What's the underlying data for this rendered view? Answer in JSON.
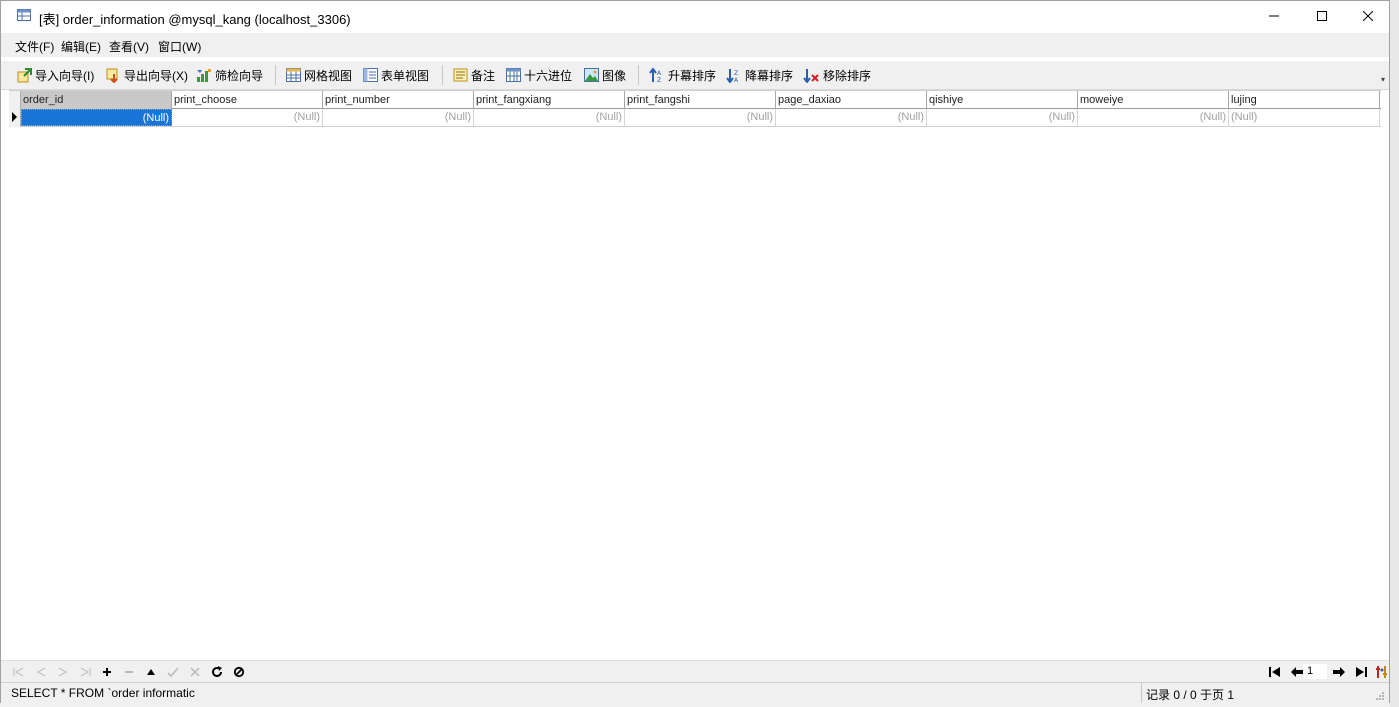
{
  "window": {
    "title": "[表] order_information @mysql_kang (localhost_3306)"
  },
  "menu": [
    {
      "label": "文件(F)"
    },
    {
      "label": "编辑(E)"
    },
    {
      "label": "查看(V)"
    },
    {
      "label": "窗口(W)"
    }
  ],
  "toolbar": {
    "import_label": "导入向导(I)",
    "export_label": "导出向导(X)",
    "filter_label": "筛检向导",
    "grid_view_label": "网格视图",
    "form_view_label": "表单视图",
    "memo_label": "备注",
    "hex_label": "十六进位",
    "image_label": "图像",
    "sort_asc_label": "升幕排序",
    "sort_desc_label": "降幕排序",
    "remove_sort_label": "移除排序"
  },
  "grid": {
    "columns": [
      "order_id",
      "print_choose",
      "print_number",
      "print_fangxiang",
      "print_fangshi",
      "page_daxiao",
      "qishiye",
      "moweiye",
      "lujing"
    ],
    "rows": [
      [
        "(Null)",
        "(Null)",
        "(Null)",
        "(Null)",
        "(Null)",
        "(Null)",
        "(Null)",
        "(Null)",
        "(Null)"
      ]
    ],
    "selected_column": "order_id"
  },
  "nav": {
    "page_value": "1"
  },
  "status": {
    "sql_text": "SELECT * FROM `order informatic",
    "record_text": "记录 0 / 0 于页 1"
  },
  "colors": {
    "selection": "#1874d6",
    "null_text": "#a0a0a0"
  }
}
